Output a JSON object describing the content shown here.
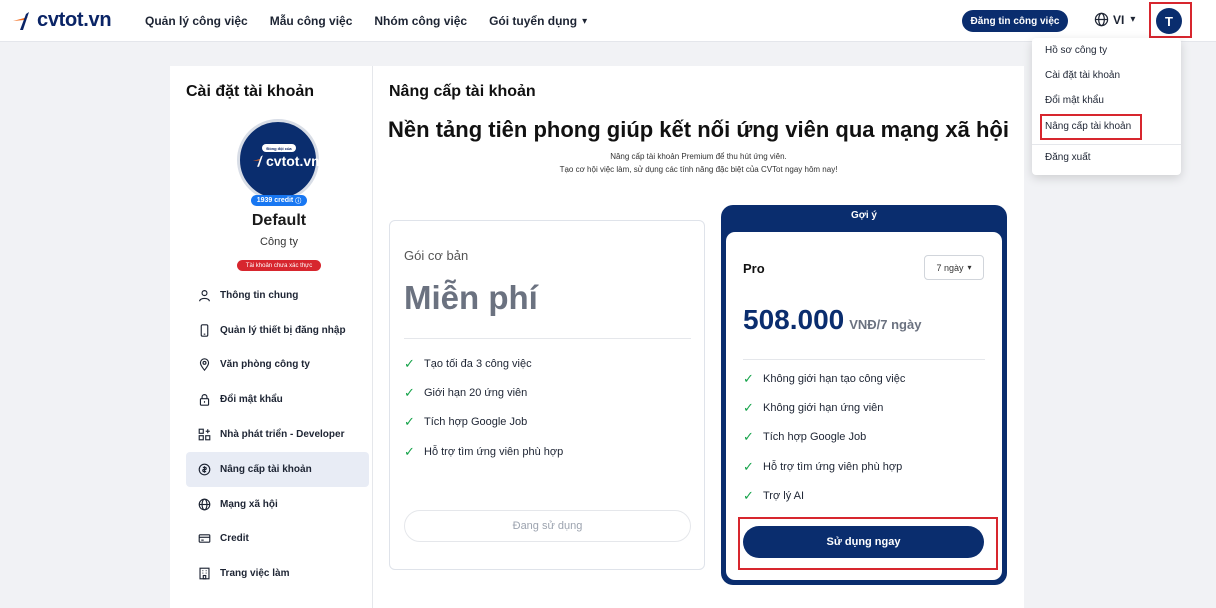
{
  "nav": {
    "logo_text": "cvtot.vn",
    "links": [
      {
        "label": "Quản lý công việc"
      },
      {
        "label": "Mẫu công việc"
      },
      {
        "label": "Nhóm công việc"
      },
      {
        "label": "Gói tuyển dụng"
      }
    ],
    "post_job_label": "Đăng tin công việc",
    "language": "VI",
    "avatar_initial": "T"
  },
  "dropdown": {
    "items": [
      {
        "label": "Hồ sơ công ty"
      },
      {
        "label": "Cài đặt tài khoản"
      },
      {
        "label": "Đổi mật khẩu"
      },
      {
        "label": "Nâng cấp tài khoản"
      },
      {
        "label": "Đăng xuất"
      }
    ]
  },
  "sidebar": {
    "title": "Cài đặt tài khoản",
    "logo_badge": "Đồng đội của",
    "logo_text": "cvtot.vn",
    "credit": "1939 credit",
    "company_name": "Default",
    "company_type": "Công ty",
    "unverified": "Tài khoản chưa xác thực",
    "items": [
      {
        "label": "Thông tin chung",
        "icon": "user-icon"
      },
      {
        "label": "Quản lý thiết bị đăng nhập",
        "icon": "device-icon"
      },
      {
        "label": "Văn phòng công ty",
        "icon": "location-icon"
      },
      {
        "label": "Đổi mật khẩu",
        "icon": "lock-icon"
      },
      {
        "label": "Nhà phát triển - Developer",
        "icon": "developer-icon"
      },
      {
        "label": "Nâng cấp tài khoản",
        "icon": "upgrade-icon",
        "active": true
      },
      {
        "label": "Mạng xã hội",
        "icon": "globe-icon"
      },
      {
        "label": "Credit",
        "icon": "credit-card-icon"
      },
      {
        "label": "Trang việc làm",
        "icon": "building-icon"
      }
    ]
  },
  "content": {
    "title": "Nâng cấp tài khoản",
    "headline": "Nền tảng tiên phong giúp kết nối ứng viên qua mạng xã hội",
    "subtitle_1": "Nâng cấp tài khoản Premium để thu hút ứng viên.",
    "subtitle_2": "Tạo cơ hội việc làm, sử dụng các tính năng đặc biệt của CVTot ngay hôm nay!"
  },
  "plans": {
    "free": {
      "label": "Gói cơ bản",
      "price": "Miễn phí",
      "features": [
        "Tạo tối đa 3 công việc",
        "Giới hạn 20 ứng viên",
        "Tích hợp Google Job",
        "Hỗ trợ tìm ứng viên phù hợp"
      ],
      "button_label": "Đang sử dụng"
    },
    "pro": {
      "header": "Gợi ý",
      "name": "Pro",
      "duration": "7 ngày",
      "price": "508.000",
      "price_unit": "VNĐ/7 ngày",
      "features": [
        "Không giới hạn tạo công việc",
        "Không giới hạn ứng viên",
        "Tích hợp Google Job",
        "Hỗ trợ tìm ứng viên phù hợp",
        "Trợ lý AI"
      ],
      "button_label": "Sử dụng ngay"
    }
  },
  "colors": {
    "brand": "#0a2d6e",
    "accent_red": "#d7262e",
    "check_green": "#16a34a",
    "credit_blue": "#1877f2"
  }
}
